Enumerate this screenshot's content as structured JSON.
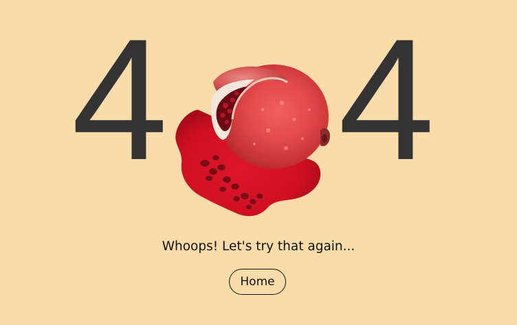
{
  "error": {
    "digit_left": "4",
    "digit_right": "4",
    "middle_image": "pomegranate-illustration"
  },
  "message": "Whoops! Let's try that again...",
  "home_button_label": "Home",
  "colors": {
    "background": "#f9dca9",
    "digits": "#333333",
    "text": "#111111",
    "accent_red": "#d81a2a"
  }
}
